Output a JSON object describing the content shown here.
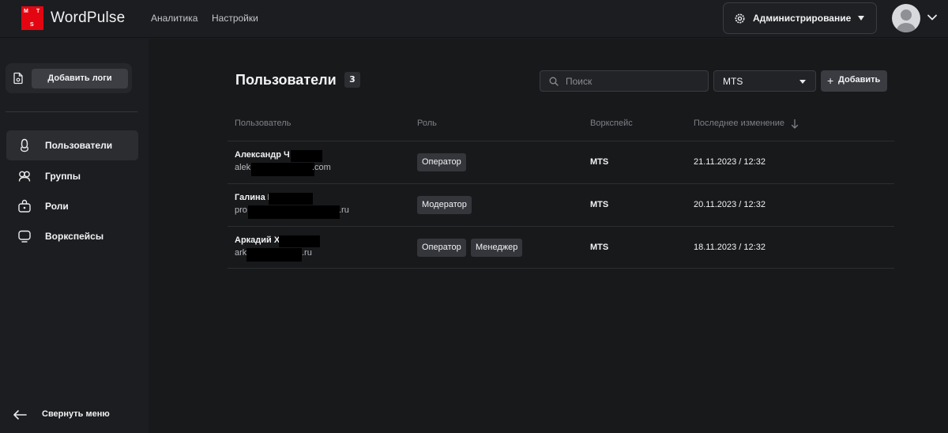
{
  "app": {
    "logo_letters": [
      "M",
      "T",
      "S"
    ],
    "name": "WordPulse",
    "brand_color": "#e30611"
  },
  "header": {
    "nav": [
      {
        "label": "Аналитика"
      },
      {
        "label": "Настройки"
      }
    ],
    "admin_button": {
      "label": "Администрирование",
      "icon": "gear-icon"
    },
    "user_menu": {
      "icon": "avatar",
      "chevron": "chevron-down-icon"
    }
  },
  "sidebar": {
    "upload_button": {
      "label": "Добавить логи",
      "icon": "document-icon"
    },
    "items": [
      {
        "label": "Пользователи",
        "icon": "user-icon",
        "active": true
      },
      {
        "label": "Группы",
        "icon": "groups-icon",
        "active": false
      },
      {
        "label": "Роли",
        "icon": "role-icon",
        "active": false
      },
      {
        "label": "Воркспейсы",
        "icon": "monitor-icon",
        "active": false
      }
    ],
    "collapse": {
      "label": "Свернуть меню",
      "icon": "arrow-left-icon"
    }
  },
  "main": {
    "title": "Пользователи",
    "count": "3",
    "search": {
      "placeholder": "Поиск",
      "value": ""
    },
    "workspace_filter": {
      "value": "MTS"
    },
    "add_button": {
      "label": "Добавить"
    },
    "columns": {
      "user": "Пользователь",
      "role": "Роль",
      "workspace": "Воркспейс",
      "modified": "Последнее изменение"
    },
    "rows": [
      {
        "name": "Александр Ч",
        "email_start": "alek",
        "email_end": ".com",
        "roles": [
          "Оператор"
        ],
        "workspace": "MTS",
        "modified": "21.11.2023 / 12:32"
      },
      {
        "name": "Галина П",
        "email_start": "pro",
        "email_end": ".ru",
        "roles": [
          "Модератор"
        ],
        "workspace": "MTS",
        "modified": "20.11.2023 / 12:32"
      },
      {
        "name": "Аркадий Х",
        "email_start": "ark",
        "email_end": ".ru",
        "roles": [
          "Оператор",
          "Менеджер"
        ],
        "workspace": "MTS",
        "modified": "18.11.2023 / 12:32"
      }
    ]
  }
}
